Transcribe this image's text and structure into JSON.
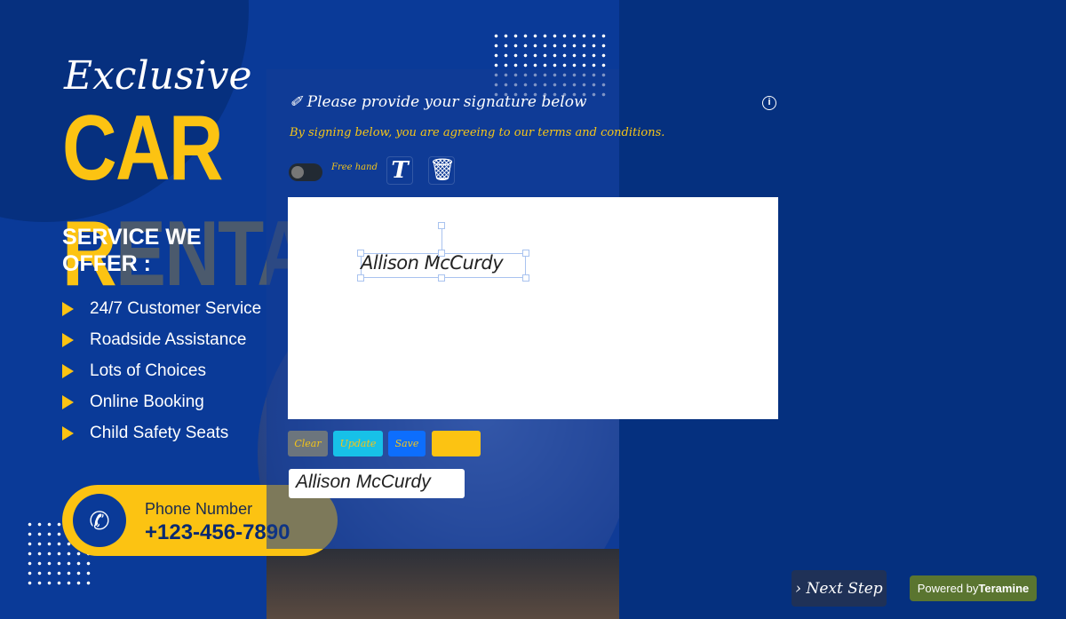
{
  "ad": {
    "exclusive": "Exclusive",
    "headline_a": "CAR R",
    "headline_b": "ENTAL",
    "service": "SERVICE WE OFFER :",
    "services": [
      "24/7 Customer Service",
      "Roadside Assistance",
      "Lots of Choices",
      "Online Booking",
      "Child Safety Seats"
    ],
    "phone_label": "Phone Number",
    "phone": "+123-456-7890"
  },
  "signature": {
    "title": "Please provide your signature below",
    "terms": "By signing below, you are agreeing to our terms and conditions.",
    "free_hand_label": "Free hand",
    "free_hand_on": false,
    "text_tool": "T",
    "signature_text": "Allison McCurdy",
    "buttons": {
      "clear": "Clear",
      "update": "Update",
      "save": "Save",
      "extra": ""
    },
    "preview": "Allison McCurdy"
  },
  "footer": {
    "next": "Next Step",
    "powered": "Powered by",
    "brand": "Teramine"
  },
  "colors": {
    "accent": "#fcc312",
    "background": "#05307f",
    "save": "#0d6efd",
    "update": "#17c1e8",
    "clear": "#6c757d",
    "powered": "#5a7530"
  }
}
